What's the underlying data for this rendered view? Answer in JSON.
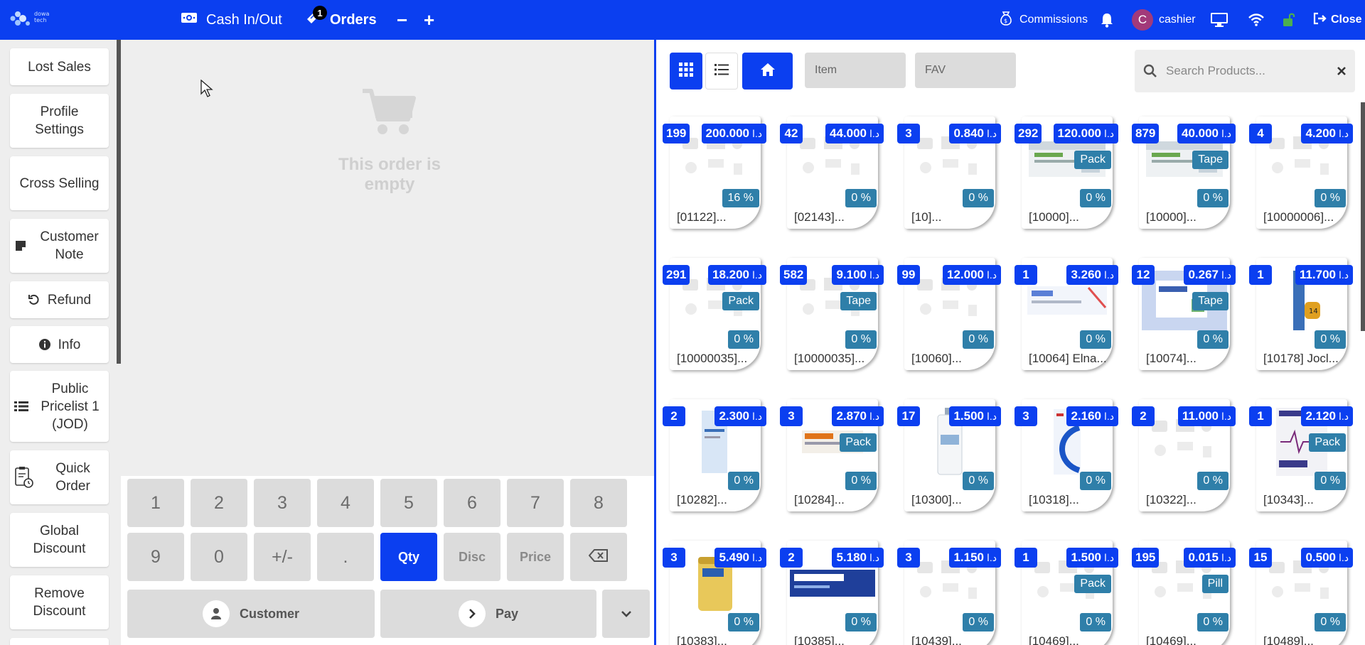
{
  "topbar": {
    "logo_text": "dowa tech",
    "cash_in_out": "Cash In/Out",
    "orders": "Orders",
    "orders_badge": "1",
    "minus": "−",
    "plus": "+",
    "commissions": "Commissions",
    "user_initial": "C",
    "user_name": "cashier",
    "close": "Close"
  },
  "left_actions": [
    {
      "label": "Lost Sales",
      "icon": ""
    },
    {
      "label": "Profile Settings",
      "icon": ""
    },
    {
      "label": "Cross Selling",
      "icon": ""
    },
    {
      "label": "Customer Note",
      "icon": "note-icon"
    },
    {
      "label": "Refund",
      "icon": "undo-icon"
    },
    {
      "label": "Info",
      "icon": "info-icon"
    },
    {
      "label": "Public Pricelist 1 (JOD)",
      "icon": "list-icon"
    },
    {
      "label": "Quick Order",
      "icon": "clipboard-clock-icon"
    },
    {
      "label": "Global Discount",
      "icon": ""
    },
    {
      "label": "Remove Discount",
      "icon": ""
    }
  ],
  "order": {
    "empty_text": "This order is empty"
  },
  "numpad": {
    "row1": [
      "1",
      "2",
      "3",
      "4",
      "5",
      "6",
      "7",
      "8"
    ],
    "row2": [
      "9",
      "0",
      "+/-",
      ".",
      "Qty",
      "Disc",
      "Price"
    ],
    "active_mode": "Qty",
    "customer": "Customer",
    "pay": "Pay"
  },
  "products_toolbar": {
    "categories": [
      "Item",
      "FAV"
    ],
    "search_placeholder": "Search Products..."
  },
  "currency": "د.ا",
  "colors": {
    "primary": "#0b3ff0",
    "tag": "#2f7fa9",
    "key": "#dcdcdc"
  },
  "products": [
    {
      "stock": "199",
      "price": "200.000",
      "pkg": "",
      "disc": "16 %",
      "name": "[01122]...",
      "img": "placeholder"
    },
    {
      "stock": "42",
      "price": "44.000",
      "pkg": "",
      "disc": "0 %",
      "name": "[02143]...",
      "img": "placeholder"
    },
    {
      "stock": "3",
      "price": "0.840",
      "pkg": "",
      "disc": "0 %",
      "name": "[10]...",
      "img": "placeholder"
    },
    {
      "stock": "292",
      "price": "120.000",
      "pkg": "Pack",
      "disc": "0 %",
      "name": "[10000]...",
      "img": "box-green"
    },
    {
      "stock": "879",
      "price": "40.000",
      "pkg": "Tape",
      "disc": "0 %",
      "name": "[10000]...",
      "img": "box-green"
    },
    {
      "stock": "4",
      "price": "4.200",
      "pkg": "",
      "disc": "0 %",
      "name": "[10000006]...",
      "img": "placeholder"
    },
    {
      "stock": "291",
      "price": "18.200",
      "pkg": "Pack",
      "disc": "0 %",
      "name": "[10000035]...",
      "img": "placeholder"
    },
    {
      "stock": "582",
      "price": "9.100",
      "pkg": "Tape",
      "disc": "0 %",
      "name": "[10000035]...",
      "img": "placeholder"
    },
    {
      "stock": "99",
      "price": "12.000",
      "pkg": "",
      "disc": "0 %",
      "name": "[10060]...",
      "img": "placeholder"
    },
    {
      "stock": "1",
      "price": "3.260",
      "pkg": "",
      "disc": "0 %",
      "name": "[10064] Elna...",
      "img": "box-blue"
    },
    {
      "stock": "12",
      "price": "0.267",
      "pkg": "Tape",
      "disc": "0 %",
      "name": "[10074]...",
      "img": "box-movicol"
    },
    {
      "stock": "1",
      "price": "11.700",
      "pkg": "",
      "disc": "0 %",
      "name": "[10178] Jocl...",
      "img": "tube-orange"
    },
    {
      "stock": "2",
      "price": "2.300",
      "pkg": "",
      "disc": "0 %",
      "name": "[10282]...",
      "img": "bottle-blue"
    },
    {
      "stock": "3",
      "price": "2.870",
      "pkg": "Pack",
      "disc": "0 %",
      "name": "[10284]...",
      "img": "box-orange"
    },
    {
      "stock": "17",
      "price": "1.500",
      "pkg": "",
      "disc": "0 %",
      "name": "[10300]...",
      "img": "bottle-white"
    },
    {
      "stock": "3",
      "price": "2.160",
      "pkg": "",
      "disc": "0 %",
      "name": "[10318]...",
      "img": "box-blue-swoosh"
    },
    {
      "stock": "2",
      "price": "11.000",
      "pkg": "",
      "disc": "0 %",
      "name": "[10322]...",
      "img": "placeholder"
    },
    {
      "stock": "1",
      "price": "2.120",
      "pkg": "Pack",
      "disc": "0 %",
      "name": "[10343]...",
      "img": "box-purple"
    },
    {
      "stock": "3",
      "price": "5.490",
      "pkg": "",
      "disc": "0 %",
      "name": "[10383]...",
      "img": "can-gold"
    },
    {
      "stock": "2",
      "price": "5.180",
      "pkg": "",
      "disc": "0 %",
      "name": "[10385]...",
      "img": "box-lamisil"
    },
    {
      "stock": "3",
      "price": "1.150",
      "pkg": "",
      "disc": "0 %",
      "name": "[10439]...",
      "img": "placeholder"
    },
    {
      "stock": "1",
      "price": "1.500",
      "pkg": "Pack",
      "disc": "0 %",
      "name": "[10469]...",
      "img": "placeholder"
    },
    {
      "stock": "195",
      "price": "0.015",
      "pkg": "Pill",
      "disc": "0 %",
      "name": "[10469]...",
      "img": "placeholder"
    },
    {
      "stock": "15",
      "price": "0.500",
      "pkg": "",
      "disc": "0 %",
      "name": "[10489]...",
      "img": "placeholder"
    }
  ]
}
